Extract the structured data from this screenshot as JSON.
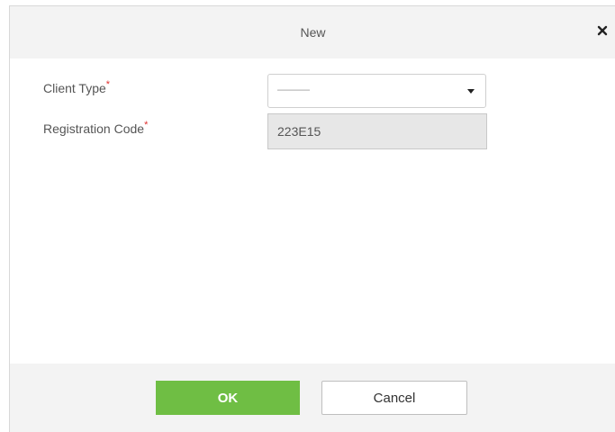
{
  "dialog": {
    "title": "New",
    "close_icon": "close-icon"
  },
  "form": {
    "client_type": {
      "label": "Client Type",
      "required_mark": "*",
      "selected_value": "———"
    },
    "registration_code": {
      "label": "Registration Code",
      "required_mark": "*",
      "value": "223E15"
    }
  },
  "footer": {
    "ok_label": "OK",
    "cancel_label": "Cancel"
  },
  "colors": {
    "ok_button": "#6fbe44",
    "required_mark": "#e0312f",
    "header_background": "#f3f3f3"
  }
}
